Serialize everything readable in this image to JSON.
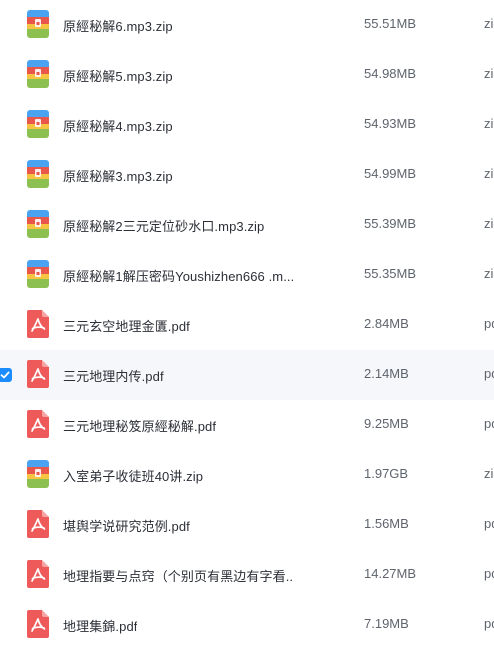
{
  "files": [
    {
      "name": "原經秘解6.mp3.zip",
      "size": "55.51MB",
      "type": "zip",
      "icon": "zip-archive-icon",
      "selected": false
    },
    {
      "name": "原經秘解5.mp3.zip",
      "size": "54.98MB",
      "type": "zip",
      "icon": "zip-archive-icon",
      "selected": false
    },
    {
      "name": "原經秘解4.mp3.zip",
      "size": "54.93MB",
      "type": "zip",
      "icon": "zip-archive-icon",
      "selected": false
    },
    {
      "name": "原經秘解3.mp3.zip",
      "size": "54.99MB",
      "type": "zip",
      "icon": "zip-archive-icon",
      "selected": false
    },
    {
      "name": "原經秘解2三元定位砂水口.mp3.zip",
      "size": "55.39MB",
      "type": "zip",
      "icon": "zip-archive-icon",
      "selected": false
    },
    {
      "name": "原經秘解1解压密码Youshizhen666 .m...",
      "size": "55.35MB",
      "type": "zip",
      "icon": "zip-archive-icon",
      "selected": false
    },
    {
      "name": "三元玄空地理金匱.pdf",
      "size": "2.84MB",
      "type": "pdf",
      "icon": "pdf-icon",
      "selected": false
    },
    {
      "name": "三元地理内传.pdf",
      "size": "2.14MB",
      "type": "pdf",
      "icon": "pdf-icon",
      "selected": true
    },
    {
      "name": "三元地理秘笈原經秘解.pdf",
      "size": "9.25MB",
      "type": "pdf",
      "icon": "pdf-icon",
      "selected": false
    },
    {
      "name": "入室弟子收徒班40讲.zip",
      "size": "1.97GB",
      "type": "zip",
      "icon": "zip-archive-icon",
      "selected": false
    },
    {
      "name": "堪舆学说研究范例.pdf",
      "size": "1.56MB",
      "type": "pdf",
      "icon": "pdf-icon",
      "selected": false
    },
    {
      "name": "地理指要与点窍（个别页有黑边有字看...",
      "size": "14.27MB",
      "type": "pdf",
      "icon": "pdf-icon",
      "selected": false
    },
    {
      "name": "地理集錦.pdf",
      "size": "7.19MB",
      "type": "pdf",
      "icon": "pdf-icon",
      "selected": false
    }
  ],
  "colors": {
    "pdf": "#ee5a5a",
    "zip_blue": "#4aa3f0",
    "zip_red": "#e8574a",
    "zip_yellow": "#f6c343",
    "zip_green": "#8cc152",
    "selected_bg": "#f5f7fb",
    "checkbox": "#1a8cff"
  }
}
